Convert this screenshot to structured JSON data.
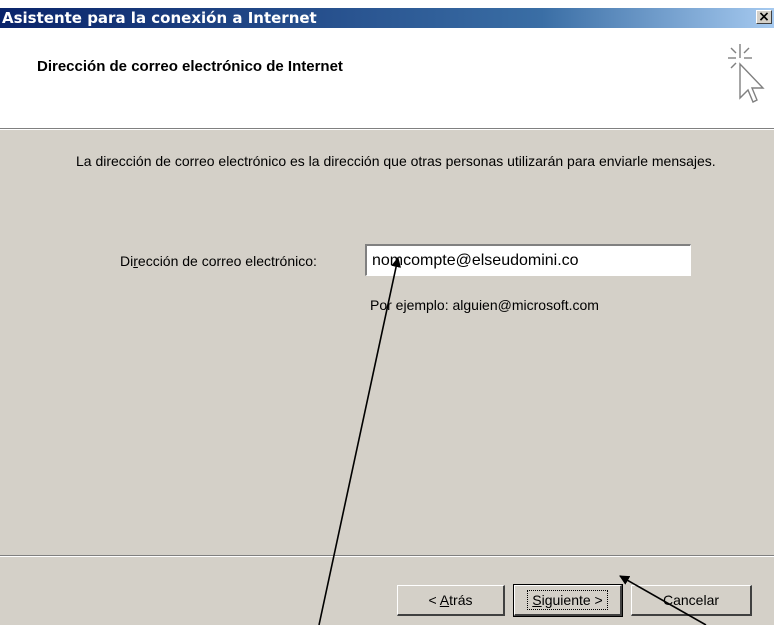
{
  "window": {
    "title": "Asistente para la conexión a Internet",
    "close_label": "×"
  },
  "header": {
    "title": "Dirección de correo electrónico de Internet",
    "icon": "wizard-cursor-icon"
  },
  "main": {
    "description": "La dirección de correo electrónico es la dirección que otras personas utilizarán para enviarle mensajes.",
    "email_label_pre": "Di",
    "email_label_accel": "r",
    "email_label_post": "ección de correo electrónico:",
    "email_value": "nomcompte@elseudomini.co",
    "example": "Por ejemplo: alguien@microsoft.com"
  },
  "footer": {
    "back_pre": "< ",
    "back_accel": "A",
    "back_post": "trás",
    "next_accel": "S",
    "next_post": "iguiente >",
    "cancel_label": "Cancelar"
  },
  "colors": {
    "dialog_face": "#d4d0c8",
    "titlebar": "#0a246a"
  }
}
